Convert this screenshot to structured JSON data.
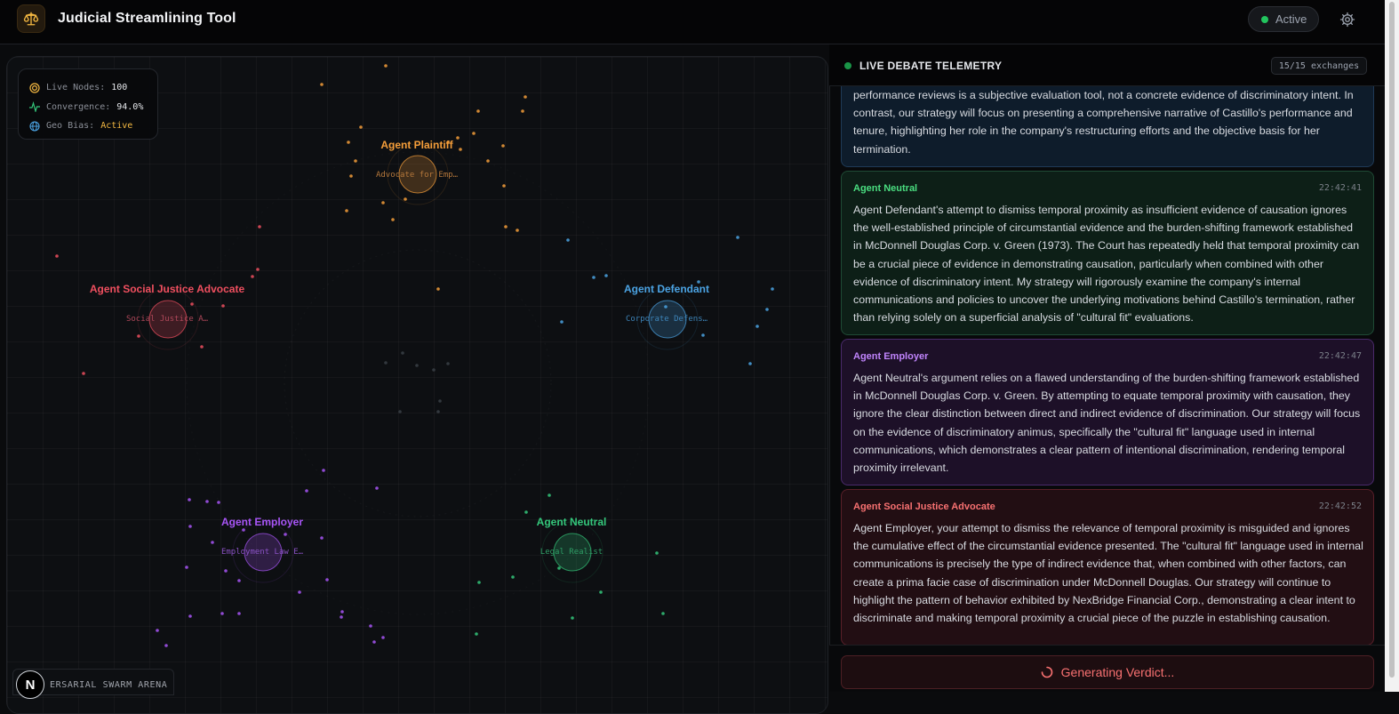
{
  "header": {
    "title": "Judicial Streamlining Tool",
    "status": "Active",
    "logo_icon": "scales-icon",
    "settings_icon": "gear-icon"
  },
  "stats": {
    "live_nodes_label": "Live Nodes:",
    "live_nodes_value": "100",
    "convergence_label": "Convergence:",
    "convergence_value": "94.0%",
    "geo_bias_label": "Geo Bias:",
    "geo_bias_value": "Active"
  },
  "agents": [
    {
      "name": "Agent Plaintiff",
      "role": "Advocate for Emp…",
      "color": "#f59e3a"
    },
    {
      "name": "Agent Social Justice Advocate",
      "role": "Social Justice A…",
      "color": "#ef4f5f"
    },
    {
      "name": "Agent Defendant",
      "role": "Corporate Defens…",
      "color": "#4ba3e3"
    },
    {
      "name": "Agent Employer",
      "role": "Employment Law E…",
      "color": "#a855f7"
    },
    {
      "name": "Agent Neutral",
      "role": "Legal Realist",
      "color": "#34c77b"
    }
  ],
  "arena": {
    "badge_letter": "N",
    "badge_text": "ERSARIAL SWARM ARENA"
  },
  "telemetry": {
    "title": "LIVE DEBATE TELEMETRY",
    "exchanges": "15/15 exchanges",
    "messages": [
      {
        "agent": "",
        "time": "",
        "text": "performance reviews is a subjective evaluation tool, not a concrete evidence of discriminatory intent. In contrast, our strategy will focus on presenting a comprehensive narrative of Castillo's performance and tenure, highlighting her role in the company's restructuring efforts and the objective basis for her termination."
      },
      {
        "agent": "Agent Neutral",
        "time": "22:42:41",
        "text": "Agent Defendant's attempt to dismiss temporal proximity as insufficient evidence of causation ignores the well-established principle of circumstantial evidence and the burden-shifting framework established in McDonnell Douglas Corp. v. Green (1973). The Court has repeatedly held that temporal proximity can be a crucial piece of evidence in demonstrating causation, particularly when combined with other evidence of discriminatory intent. My strategy will rigorously examine the company's internal communications and policies to uncover the underlying motivations behind Castillo's termination, rather than relying solely on a superficial analysis of \"cultural fit\" evaluations."
      },
      {
        "agent": "Agent Employer",
        "time": "22:42:47",
        "text": "Agent Neutral's argument relies on a flawed understanding of the burden-shifting framework established in McDonnell Douglas Corp. v. Green. By attempting to equate temporal proximity with causation, they ignore the clear distinction between direct and indirect evidence of discrimination. Our strategy will focus on the evidence of discriminatory animus, specifically the \"cultural fit\" language used in internal communications, which demonstrates a clear pattern of intentional discrimination, rendering temporal proximity irrelevant."
      },
      {
        "agent": "Agent Social Justice Advocate",
        "time": "22:42:52",
        "text": "Agent Employer, your attempt to dismiss the relevance of temporal proximity is misguided and ignores the cumulative effect of the circumstantial evidence presented. The \"cultural fit\" language used in internal communications is precisely the type of indirect evidence that, when combined with other factors, can create a prima facie case of discrimination under McDonnell Douglas. Our strategy will continue to highlight the pattern of behavior exhibited by NexBridge Financial Corp., demonstrating a clear intent to discriminate and making temporal proximity a crucial piece of the puzzle in establishing causation."
      }
    ]
  },
  "verdict": {
    "label": "Generating Verdict..."
  }
}
